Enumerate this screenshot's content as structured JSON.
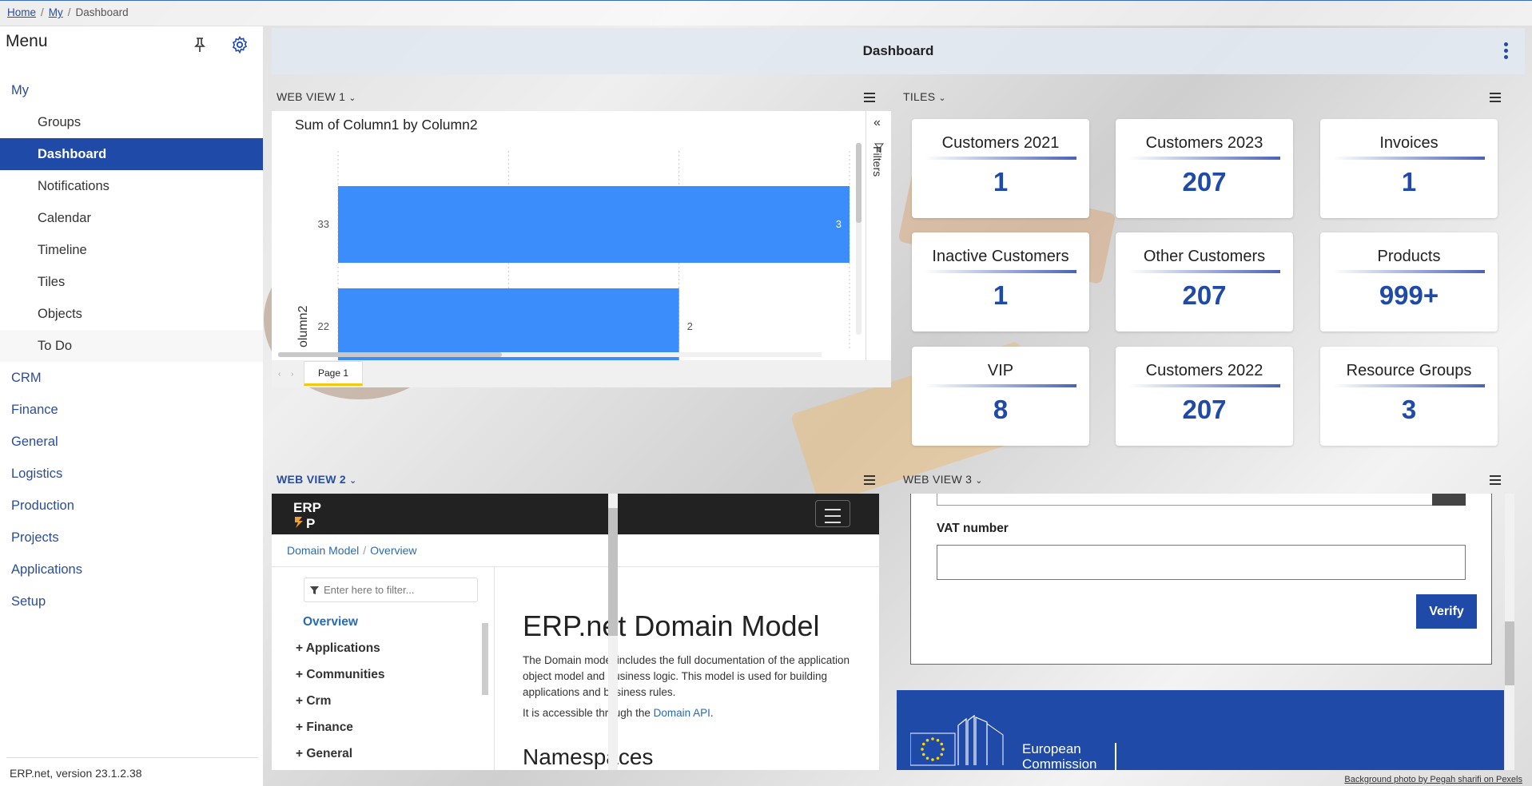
{
  "breadcrumb": {
    "home": "Home",
    "my": "My",
    "current": "Dashboard"
  },
  "sidebar": {
    "title": "Menu",
    "items": [
      {
        "label": "My",
        "level": "top"
      },
      {
        "label": "Groups",
        "level": "sub"
      },
      {
        "label": "Dashboard",
        "level": "sub",
        "active": true
      },
      {
        "label": "Notifications",
        "level": "sub"
      },
      {
        "label": "Calendar",
        "level": "sub"
      },
      {
        "label": "Timeline",
        "level": "sub"
      },
      {
        "label": "Tiles",
        "level": "sub"
      },
      {
        "label": "Objects",
        "level": "sub"
      },
      {
        "label": "To Do",
        "level": "sub"
      },
      {
        "label": "CRM",
        "level": "top"
      },
      {
        "label": "Finance",
        "level": "top"
      },
      {
        "label": "General",
        "level": "top"
      },
      {
        "label": "Logistics",
        "level": "top"
      },
      {
        "label": "Production",
        "level": "top"
      },
      {
        "label": "Projects",
        "level": "top"
      },
      {
        "label": "Applications",
        "level": "top"
      },
      {
        "label": "Setup",
        "level": "top"
      }
    ],
    "version": "ERP.net, version 23.1.2.38"
  },
  "header": {
    "title": "Dashboard"
  },
  "panels": {
    "web_view_1": "WEB VIEW 1",
    "tiles": "TILES",
    "web_view_2": "WEB VIEW 2",
    "web_view_3": "WEB VIEW 3"
  },
  "chart_data": {
    "type": "bar",
    "orientation": "horizontal",
    "title": "Sum of Column1 by Column2",
    "ylabel": "olumn2",
    "categories": [
      "33",
      "22"
    ],
    "values": [
      3,
      2
    ],
    "data_labels": [
      "3",
      "2"
    ],
    "xlim": [
      0,
      3
    ],
    "color": "#3a8dfa",
    "filters_label": "Filters",
    "page_tab": "Page 1"
  },
  "tiles": [
    {
      "title": "Customers 2021",
      "value": "1"
    },
    {
      "title": "Customers 2023",
      "value": "207"
    },
    {
      "title": "Invoices",
      "value": "1"
    },
    {
      "title": "Inactive Customers",
      "value": "1"
    },
    {
      "title": "Other Customers",
      "value": "207"
    },
    {
      "title": "Products",
      "value": "999+"
    },
    {
      "title": "VIP",
      "value": "8"
    },
    {
      "title": "Customers 2022",
      "value": "207"
    },
    {
      "title": "Resource Groups",
      "value": "3"
    }
  ],
  "web_view_2": {
    "logo_text": "ERP",
    "breadcrumb": [
      "Domain Model",
      "Overview"
    ],
    "filter_placeholder": "Enter here to filter...",
    "tree": [
      "Overview",
      "+ Applications",
      "+ Communities",
      "+ Crm",
      "+ Finance",
      "+ General"
    ],
    "heading": "ERP.net Domain Model",
    "paragraph": "The Domain model includes the full documentation of the application object model and business logic. This model is used for building applications and business rules.",
    "accessible_prefix": "It is accessible through the ",
    "accessible_link": "Domain API",
    "accessible_suffix": ".",
    "namespaces": "Namespaces"
  },
  "web_view_3": {
    "vat_label": "VAT number",
    "verify": "Verify",
    "eu_line1": "European",
    "eu_line2": "Commission"
  },
  "credit": "Background photo by Pegah sharifi on Pexels",
  "colors": {
    "accent": "#1f4aa8",
    "bar": "#3a8dfa"
  }
}
